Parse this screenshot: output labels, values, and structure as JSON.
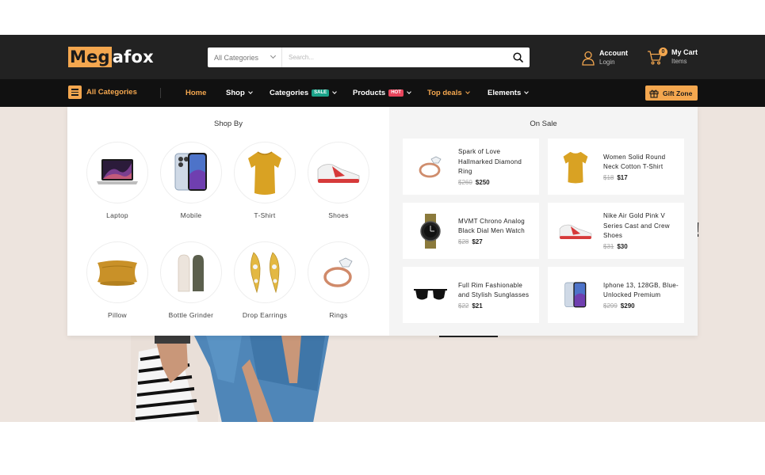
{
  "header": {
    "logo": {
      "highlight": "Meg",
      "rest": "afox"
    },
    "search": {
      "category_label": "All Categories",
      "placeholder": "Search..."
    },
    "account": {
      "title": "Account",
      "subtitle": "Login"
    },
    "cart": {
      "title": "My Cart",
      "subtitle": "Items",
      "count": "0"
    }
  },
  "nav": {
    "all_categories": "All Categories",
    "items": [
      {
        "label": "Home"
      },
      {
        "label": "Shop"
      },
      {
        "label": "Categories",
        "badge": "SALE"
      },
      {
        "label": "Products",
        "badge": "HOT"
      },
      {
        "label": "Top deals"
      },
      {
        "label": "Elements"
      }
    ],
    "gift_zone": "Gift Zone"
  },
  "mega_menu": {
    "shop_by": {
      "title": "Shop By",
      "categories": [
        {
          "name": "Laptop",
          "icon": "laptop-icon"
        },
        {
          "name": "Mobile",
          "icon": "mobile-icon"
        },
        {
          "name": "T-Shirt",
          "icon": "tshirt-icon"
        },
        {
          "name": "Shoes",
          "icon": "shoes-icon"
        },
        {
          "name": "Pillow",
          "icon": "pillow-icon"
        },
        {
          "name": "Bottle Grinder",
          "icon": "bottle-grinder-icon"
        },
        {
          "name": "Drop Earrings",
          "icon": "earrings-icon"
        },
        {
          "name": "Rings",
          "icon": "ring-icon"
        }
      ]
    },
    "on_sale": {
      "title": "On Sale",
      "products": [
        {
          "name": "Spark of Love Hallmarked Diamond Ring",
          "old_price": "$260",
          "price": "$250"
        },
        {
          "name": "Women Solid Round Neck Cotton T-Shirt",
          "old_price": "$18",
          "price": "$17"
        },
        {
          "name": "MVMT Chrono Analog Black Dial Men Watch",
          "old_price": "$28",
          "price": "$27"
        },
        {
          "name": "Nike Air Gold Pink V Series Cast and Crew Shoes",
          "old_price": "$31",
          "price": "$30"
        },
        {
          "name": "Full Rim Fashionable and Stylish Sunglasses",
          "old_price": "$22",
          "price": "$21"
        },
        {
          "name": "Iphone 13, 128GB, Blue- Unlocked Premium",
          "old_price": "$299",
          "price": "$290"
        }
      ]
    }
  },
  "hero": {
    "exclamation": "!"
  },
  "colors": {
    "accent": "#f4a74f",
    "header_bg": "#222222",
    "nav_bg": "#111111",
    "sale_badge": "#1ba38a",
    "hot_badge": "#e8455c",
    "hero_bg": "#ede4de"
  }
}
